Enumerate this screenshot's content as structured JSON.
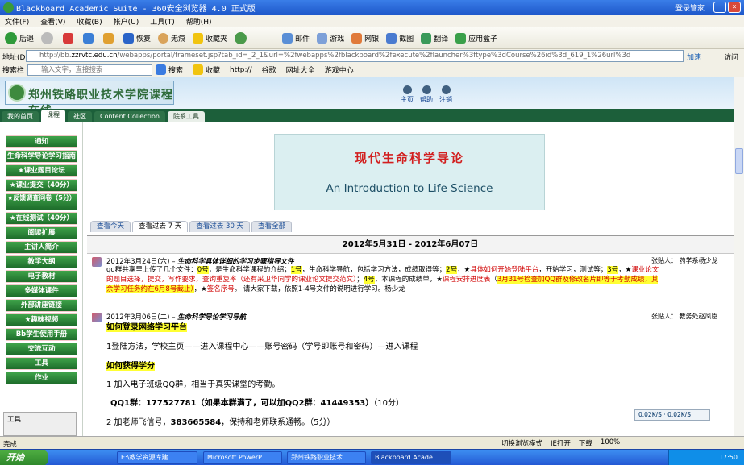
{
  "window": {
    "title": "Blackboard Academic Suite - 360安全浏览器 4.0 正式版",
    "account": "登录管家"
  },
  "menu": [
    "文件(F)",
    "查看(V)",
    "收藏(B)",
    "帐户(U)",
    "工具(T)",
    "帮助(H)"
  ],
  "toolbar": {
    "back": "后退",
    "restore": "恢复",
    "trace": "无痕",
    "favorites": "收藏夹",
    "mail": "邮件",
    "games": "游戏",
    "web": "网银",
    "screenshot": "截图",
    "translate": "翻译",
    "apps": "应用盒子"
  },
  "address": {
    "label": "地址(D)",
    "url_prefix": "http://bb.",
    "url_domain": "zzrvtc.edu.cn",
    "url_rest": "/webapps/portal/frameset.jsp?tab_id=_2_1&url=%2fwebapps%2fblackboard%2fexecute%2flauncher%3ftype%3dCourse%26id%3d_619_1%26url%3d",
    "accelerate": "加速",
    "go": "访问"
  },
  "favbar": {
    "search_label": "搜索栏",
    "search_placeholder": "输入文字，直接搜索",
    "search_btn": "搜索",
    "collect": "收藏",
    "items": [
      "http://",
      "谷歌",
      "网址大全",
      "游戏中心"
    ]
  },
  "site": {
    "logo_text": "郑州铁路职业技术学院课程在线",
    "links": [
      "主页",
      "帮助",
      "注销"
    ],
    "tabs": [
      "我的首页",
      "课程",
      "社区",
      "Content Collection",
      "院系工具"
    ]
  },
  "leftmenu": [
    "通知",
    "生命科学导论学习指南",
    "★课业题目论坛",
    "★课业提交（40分）",
    "★反馈调查问卷（5分）",
    "★在线测试（40分）",
    "阅读扩展",
    "主讲人简介",
    "教学大纲",
    "电子教材",
    "多媒体课件",
    "外部讲座链接",
    "★趣味视频",
    "Bb学生使用手册",
    "交流互动",
    "工具",
    "作业"
  ],
  "tools_box": "工具",
  "banner": {
    "cn": "现代生命科学导论",
    "en": "An Introduction to Life Science"
  },
  "view_tabs": [
    "查看今天",
    "查看过去 7 天",
    "查看过去 30 天",
    "查看全部"
  ],
  "date_range": "2012年5月31日  - 2012年6月07日",
  "ann1": {
    "date": "2012年3月24日(六) –",
    "title": "生命科学具体详细的学习步骤指导文件",
    "poster": "张贴人：  药学系杨少龙",
    "body": [
      [
        "t",
        "qq群共享里上传了几个文件："
      ],
      [
        "h",
        "0号"
      ],
      [
        "t",
        "，是生命科学课程的介绍；"
      ],
      [
        "h",
        "1号"
      ],
      [
        "t",
        "，生命科学导航，包括学习方法，成绩取得等；"
      ],
      [
        "h",
        "2号"
      ],
      [
        "t",
        "，★"
      ],
      [
        "r",
        "具体如何开始登陆平台"
      ],
      [
        "t",
        "，开始学习，测试等；"
      ],
      [
        "h",
        "3号"
      ],
      [
        "t",
        "，★"
      ],
      [
        "r",
        "课业论文的题目选择，提交，写作要求，查询重复率（还有采卫华同学的课业论文提交范文）"
      ],
      [
        "t",
        "；"
      ],
      [
        "h",
        "4号"
      ],
      [
        "t",
        "，本课程的成绩单，★"
      ],
      [
        "r",
        "课程安排进度表"
      ],
      [
        "t",
        "（"
      ],
      [
        "hr",
        "3月31号检查加QQ群及修改名片即等于考勤成绩，其余学习任务约在6月8号截止）"
      ],
      [
        "t",
        "，★"
      ],
      [
        "r",
        "签名序号"
      ],
      [
        "t",
        "。 请大家下载，依照1-4号文件的说明进行学习。杨少龙"
      ]
    ]
  },
  "ann2": {
    "date": "2012年3月06日(二) –",
    "title": "生命科学导论学习导航",
    "poster": "张贴人：  教务处赵凤臣",
    "heading1": "如何登录网络学习平台",
    "step1": "1登陆方法，学校主页——进入课程中心——账号密码（学号即账号和密码）—进入课程",
    "heading2": "如何获得学分",
    "item1": "1   加入电子班级QQ群，相当于真实课堂的考勤。",
    "qq": "QQ1群：177527781（如果本群满了，可以加QQ2群：41449353）",
    "qq_pts": "（10分）",
    "item2_pre": "2   加老师飞信号，",
    "item2_num": "383665584",
    "item2_post": "，保持和老师联系通畅。（5分）"
  },
  "netmon": {
    "down": "0.02K/S",
    "up": "0.02K/S"
  },
  "status": {
    "left": "完成",
    "items": [
      "切换浏览模式",
      "IE打开",
      "",
      "下载",
      "",
      "100%"
    ]
  },
  "taskbar": {
    "start": "开始",
    "tasks": [
      "E:\\教学资源库建...",
      "Microsoft PowerP...",
      "郑州铁路职业技术...",
      "Blackboard Acade..."
    ],
    "clock": "17:50"
  },
  "colors": {
    "green": "#1e6d2b",
    "title_blue": "#1d56c9",
    "banner_red": "#d21f1f",
    "highlight": "#ffff33"
  }
}
